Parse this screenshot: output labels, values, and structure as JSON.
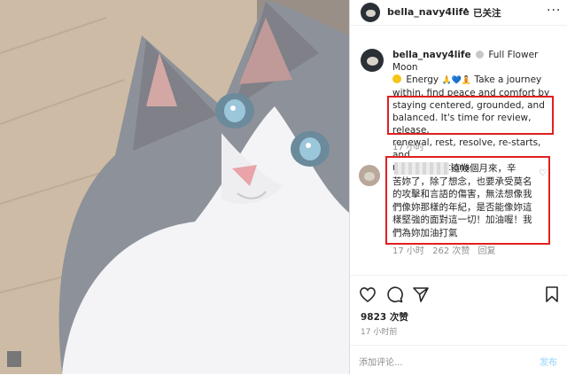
{
  "post": {
    "username": "bella_navy4life",
    "follow_status": "已关注",
    "separator": "•",
    "caption_line1": "Full Flower Moon",
    "caption_line2a": "Energy",
    "caption_line2b": "Take a journey",
    "caption_line3": "within, find peace and comfort by",
    "caption_line4": "staying centered, grounded, and",
    "caption_line5": "balanced. It's time for review, release,",
    "caption_line6": "renewal, rest, resolve, re-starts, and",
    "caption_line7": "reconsiderations.",
    "caption_time": "17 小时",
    "likes": "9823 次赞",
    "posted_time": "17 小时前"
  },
  "comment": {
    "line1": "這幾個月來，辛",
    "line2": "苦妳了，除了想念，也要承受莫名",
    "line3": "的攻擊和言語的傷害，無法想像我",
    "line4": "們像妳那樣的年紀，是否能像妳這",
    "line5": "樣堅強的面對這一切！加油喔！我",
    "line6": "們為妳加油打氣",
    "time": "17 小时",
    "likes": "262 次赞",
    "reply": "回复"
  },
  "add_comment": {
    "placeholder": "添加评论...",
    "post_label": "发布"
  },
  "colors": {
    "highlight_border": "#e02020",
    "link_blue": "#b2dffc",
    "text": "#262626",
    "muted": "#8e8e8e"
  },
  "icons": [
    "more-icon",
    "heart-icon",
    "comment-icon",
    "share-icon",
    "bookmark-icon",
    "comment-heart-icon",
    "emoji-icon"
  ]
}
